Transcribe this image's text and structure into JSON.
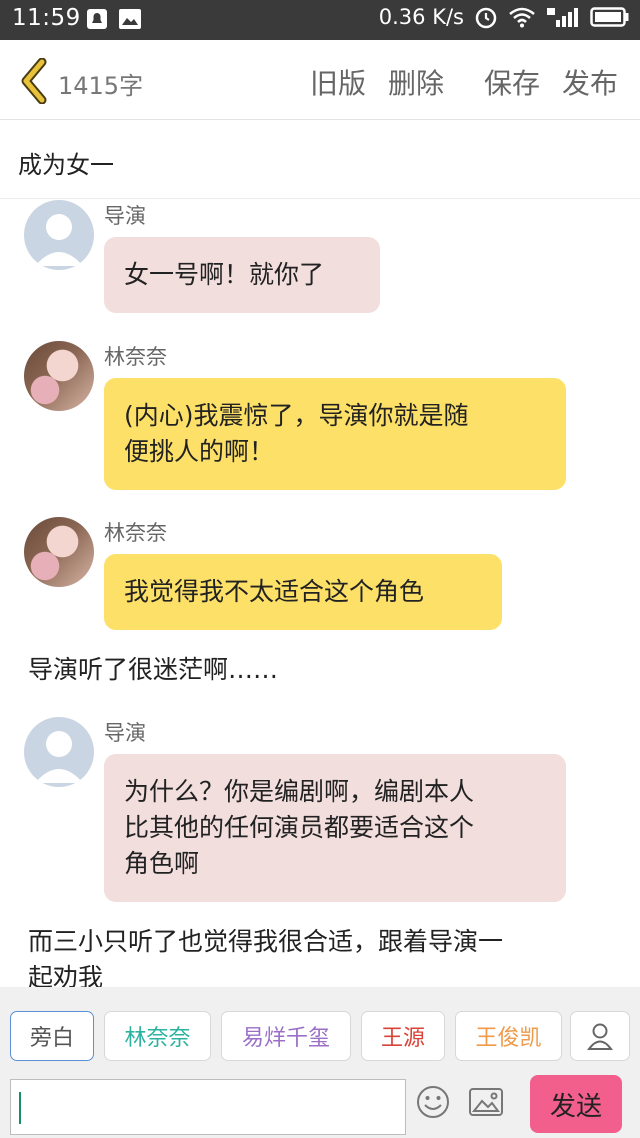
{
  "status_bar": {
    "time": "11:59",
    "network_speed": "0.36 K/s",
    "icons": [
      "notification-bell-icon",
      "image-notification-icon",
      "alarm-icon",
      "wifi-icon",
      "4g-signal-icon",
      "battery-icon"
    ]
  },
  "header": {
    "word_count": "1415字",
    "buttons": {
      "old_version": "旧版",
      "delete": "删除",
      "save": "保存",
      "publish": "发布"
    }
  },
  "title": "成为女一",
  "messages": [
    {
      "type": "dialog",
      "speaker": "导演",
      "text": "女一号啊！就你了",
      "style": "pink"
    },
    {
      "type": "dialog",
      "speaker": "林奈奈",
      "line1": "(内心)我震惊了，导演你就是随",
      "line2": "便挑人的啊！",
      "style": "yellow"
    },
    {
      "type": "dialog",
      "speaker": "林奈奈",
      "text": "我觉得我不太适合这个角色",
      "style": "yellow"
    },
    {
      "type": "narration",
      "text": "导演听了很迷茫啊……"
    },
    {
      "type": "dialog",
      "speaker": "导演",
      "line1": "为什么？你是编剧啊，编剧本人",
      "line2": "比其他的任何演员都要适合这个",
      "line3": "角色啊",
      "style": "pink"
    },
    {
      "type": "narration",
      "line1": "而三小只听了也觉得我很合适，跟着导演一",
      "line2": "起劝我"
    }
  ],
  "roles": [
    {
      "label": "旁白",
      "color": "#555555"
    },
    {
      "label": "林奈奈",
      "color": "#2bb3a0"
    },
    {
      "label": "易烊千玺",
      "color": "#9b6fc8"
    },
    {
      "label": "王源",
      "color": "#d9443a"
    },
    {
      "label": "王俊凯",
      "color": "#f09a4a"
    }
  ],
  "input": {
    "placeholder": "",
    "send_label": "发送"
  },
  "colors": {
    "accent_send": "#f25f8d",
    "bubble_pink": "#f1dedd",
    "bubble_yellow": "#fde067",
    "back_arrow": "#e8c23a"
  }
}
